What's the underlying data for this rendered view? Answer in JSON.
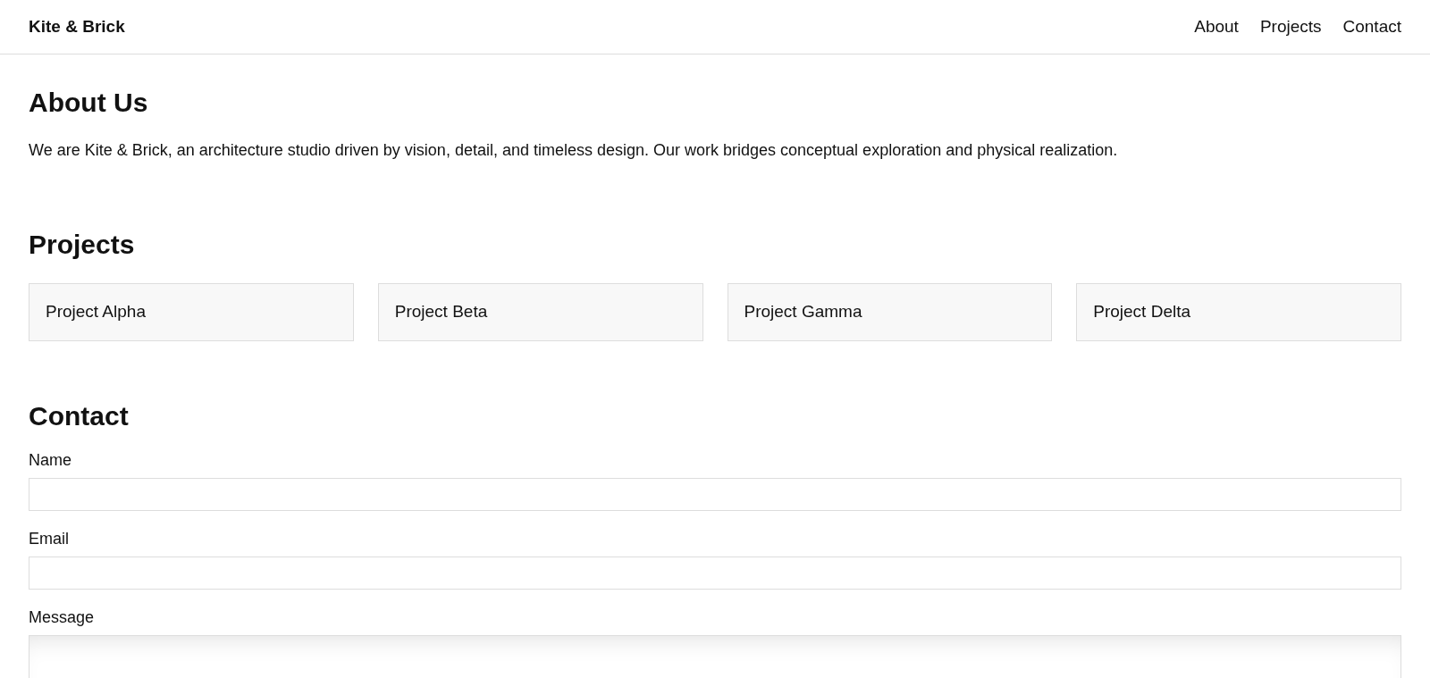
{
  "navbar": {
    "brand": "Kite & Brick",
    "links": [
      "About",
      "Projects",
      "Contact"
    ]
  },
  "about": {
    "heading": "About Us",
    "text": "We are Kite & Brick, an architecture studio driven by vision, detail, and timeless design. Our work bridges conceptual exploration and physical realization."
  },
  "projects": {
    "heading": "Projects",
    "items": [
      "Project Alpha",
      "Project Beta",
      "Project Gamma",
      "Project Delta"
    ]
  },
  "contact": {
    "heading": "Contact",
    "fields": [
      {
        "label": "Name",
        "kind": "input"
      },
      {
        "label": "Email",
        "kind": "input"
      },
      {
        "label": "Message",
        "kind": "textarea"
      }
    ]
  }
}
